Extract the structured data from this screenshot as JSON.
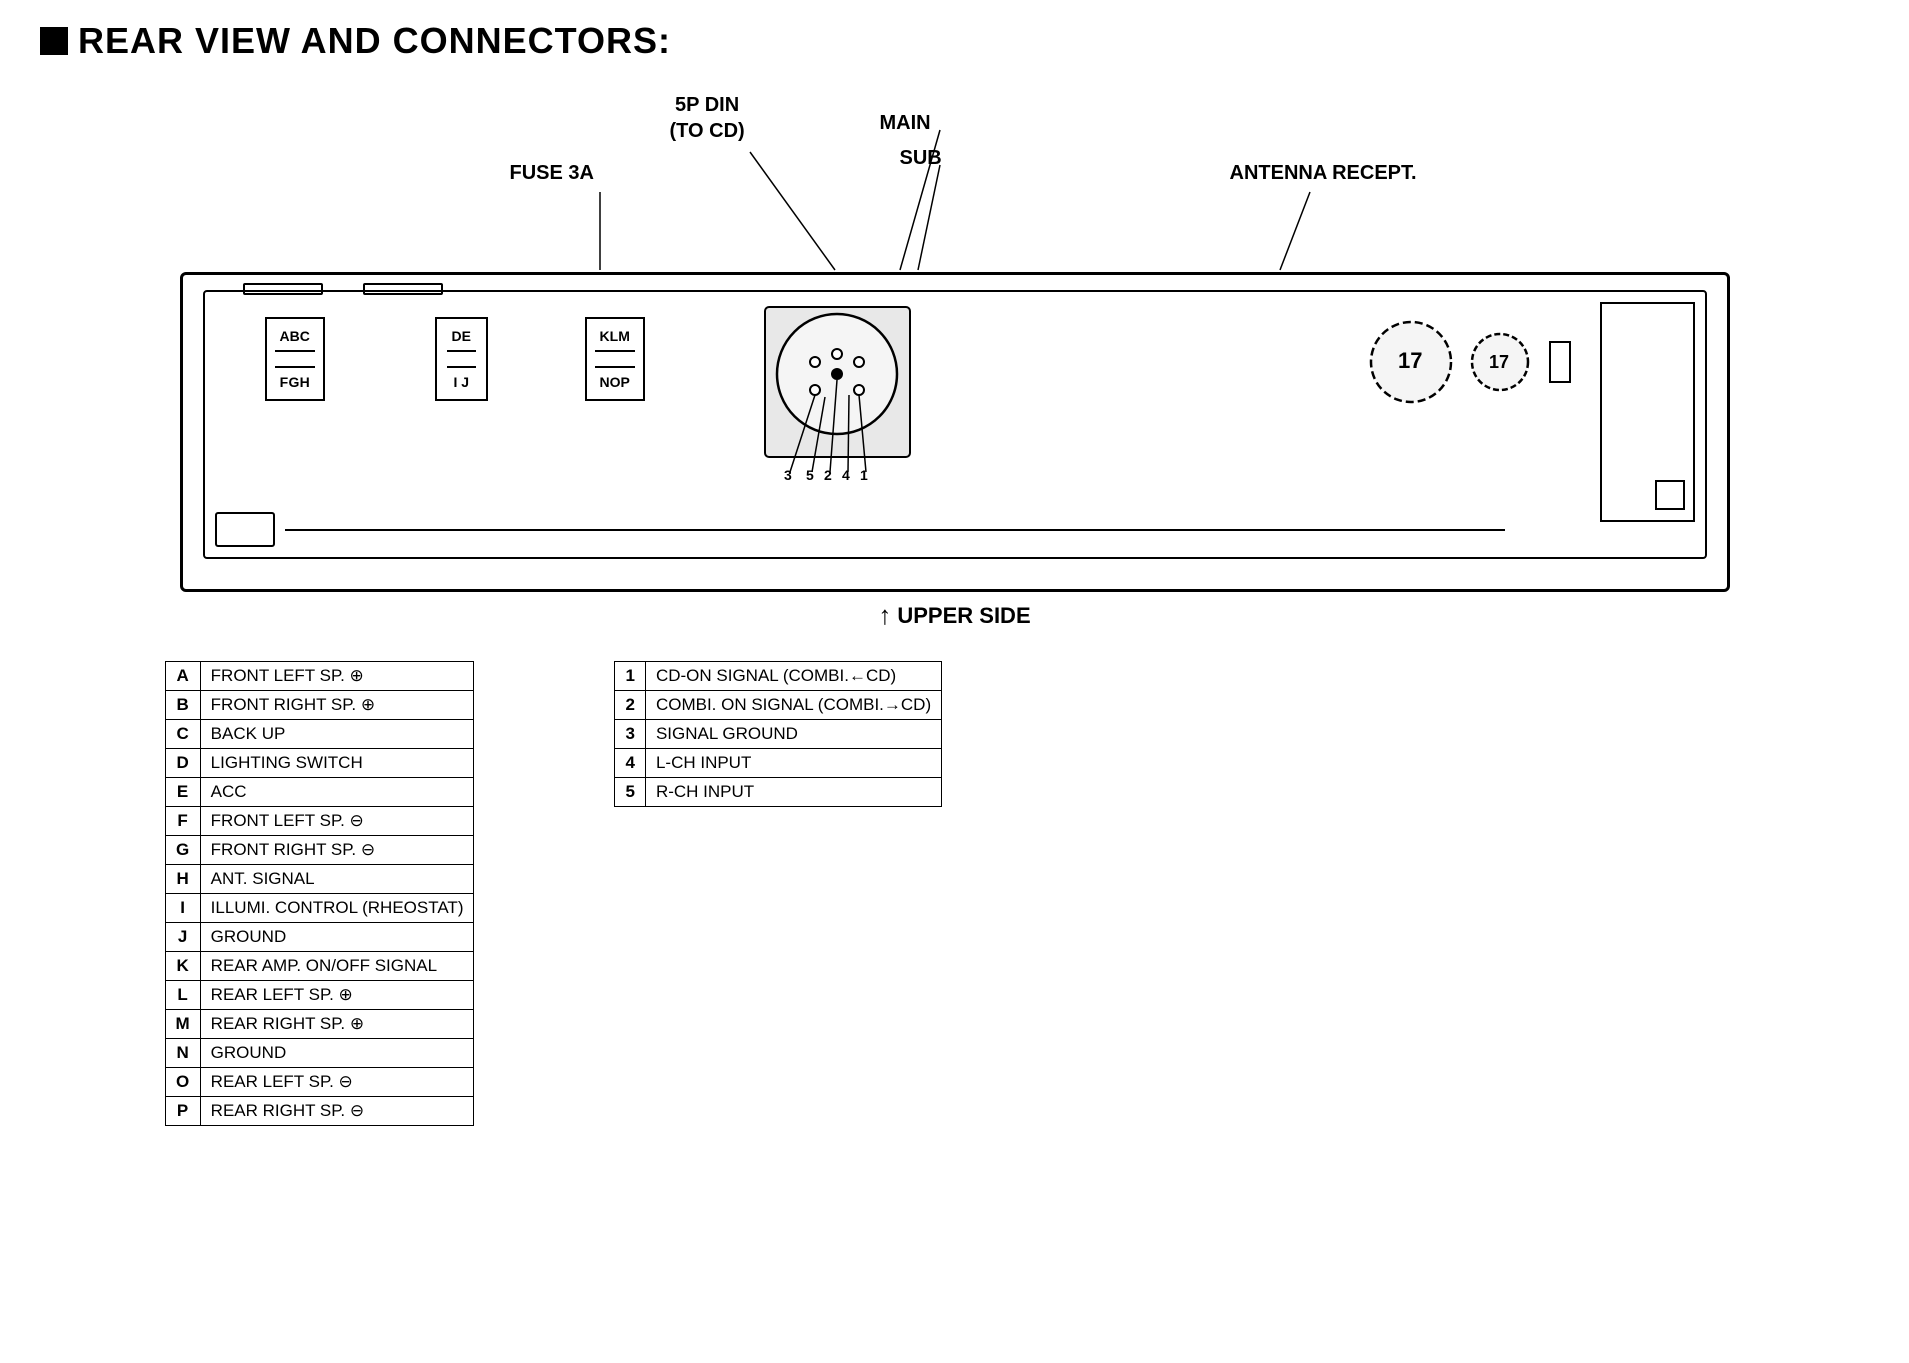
{
  "title": {
    "square": "■",
    "text": "REAR VIEW AND CONNECTORS:"
  },
  "top_labels": {
    "fuse": "FUSE 3A",
    "din5p_line1": "5P DIN",
    "din5p_line2": "(TO CD)",
    "main": "MAIN",
    "sub": "SUB",
    "antenna": "ANTENNA RECEPT."
  },
  "connector_groups": {
    "group1": {
      "top": [
        "A",
        "B",
        "C"
      ],
      "bottom": [
        "F",
        "G",
        "H"
      ]
    },
    "group2": {
      "top": [
        "D",
        "E"
      ],
      "bottom": [
        "I",
        "J"
      ]
    },
    "group3": {
      "top": [
        "K",
        "L",
        "M"
      ],
      "bottom": [
        "N",
        "O",
        "P"
      ]
    }
  },
  "upper_side_label": "UPPER SIDE",
  "pin_numbers": [
    "3",
    "5",
    "2",
    "4",
    "1"
  ],
  "legend_left": [
    {
      "id": "A",
      "desc": "FRONT LEFT SP. ⊕"
    },
    {
      "id": "B",
      "desc": "FRONT RIGHT SP. ⊕"
    },
    {
      "id": "C",
      "desc": "BACK UP"
    },
    {
      "id": "D",
      "desc": "LIGHTING SWITCH"
    },
    {
      "id": "E",
      "desc": "ACC"
    },
    {
      "id": "F",
      "desc": "FRONT LEFT SP. ⊖"
    },
    {
      "id": "G",
      "desc": "FRONT RIGHT SP. ⊖"
    },
    {
      "id": "H",
      "desc": "ANT. SIGNAL"
    },
    {
      "id": "I",
      "desc": "ILLUMI. CONTROL (RHEOSTAT)"
    },
    {
      "id": "J",
      "desc": "GROUND"
    },
    {
      "id": "K",
      "desc": "REAR AMP. ON/OFF SIGNAL"
    },
    {
      "id": "L",
      "desc": "REAR LEFT SP. ⊕"
    },
    {
      "id": "M",
      "desc": "REAR RIGHT SP. ⊕"
    },
    {
      "id": "N",
      "desc": "GROUND"
    },
    {
      "id": "O",
      "desc": "REAR LEFT SP. ⊖"
    },
    {
      "id": "P",
      "desc": "REAR RIGHT SP. ⊖"
    }
  ],
  "legend_right": [
    {
      "id": "1",
      "desc": "CD-ON SIGNAL (COMBI.←CD)"
    },
    {
      "id": "2",
      "desc": "COMBI. ON SIGNAL (COMBI.→CD)"
    },
    {
      "id": "3",
      "desc": "SIGNAL GROUND"
    },
    {
      "id": "4",
      "desc": "L-CH INPUT"
    },
    {
      "id": "5",
      "desc": "R-CH INPUT"
    }
  ]
}
